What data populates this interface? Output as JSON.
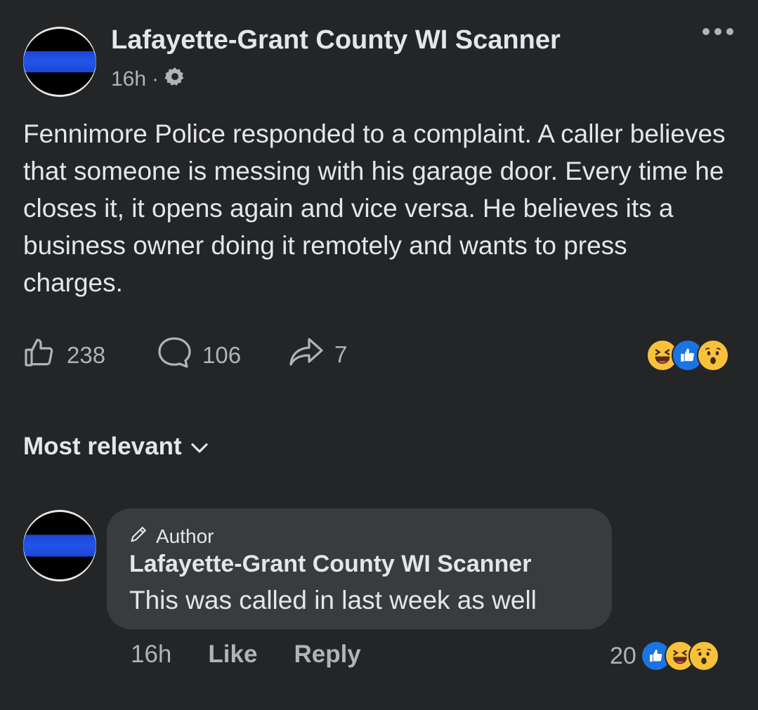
{
  "post": {
    "page_name": "Lafayette-Grant County WI Scanner",
    "time": "16h",
    "separator": "·",
    "privacy_icon": "gear-icon",
    "more_icon": "more-dots-icon",
    "text": "Fennimore Police responded to a complaint. A caller believes that someone is messing with his garage door. Every time he closes it, it opens again and vice versa. He believes its a business owner doing it remotely and wants to press charges.",
    "likes": "238",
    "comments": "106",
    "shares": "7",
    "reactions": [
      "haha",
      "like",
      "wow"
    ]
  },
  "sort": {
    "label": "Most relevant",
    "icon": "chevron-down-icon"
  },
  "comment": {
    "badge": "Author",
    "name": "Lafayette-Grant County WI Scanner",
    "text": "This was called in last week as well",
    "time": "16h",
    "like_label": "Like",
    "reply_label": "Reply",
    "reaction_count": "20",
    "reactions": [
      "like",
      "haha",
      "wow"
    ]
  },
  "colors": {
    "background": "#242526",
    "bubble": "#3a3b3c",
    "text_primary": "#e4e6eb",
    "text_secondary": "#b0b3b8",
    "like_blue": "#1b74e4",
    "emoji_yellow": "#f7c13a"
  }
}
